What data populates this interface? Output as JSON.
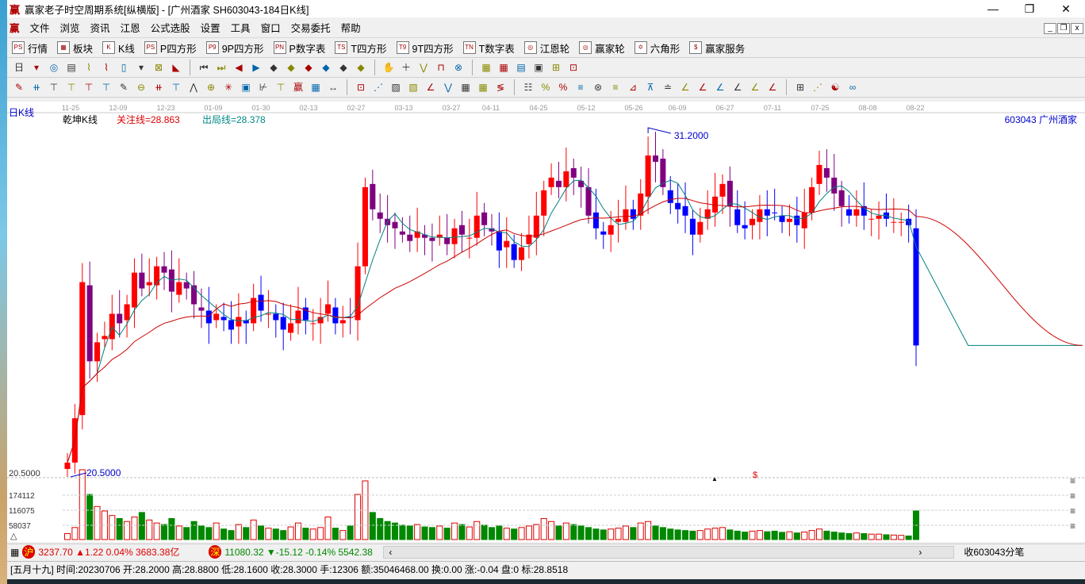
{
  "title": "赢家老子时空周期系统[纵横版] - [广州酒家  SH603043-184日K线]",
  "logo": "赢",
  "menu": [
    "文件",
    "浏览",
    "资讯",
    "江恩",
    "公式选股",
    "设置",
    "工具",
    "窗口",
    "交易委托",
    "帮助"
  ],
  "toolbar1": [
    {
      "icon": "PS",
      "label": "行情"
    },
    {
      "icon": "▦",
      "label": "板块"
    },
    {
      "icon": "K",
      "label": "K线"
    },
    {
      "icon": "PS",
      "label": "P四方形"
    },
    {
      "icon": "P9",
      "label": "9P四方形"
    },
    {
      "icon": "PN",
      "label": "P数字表"
    },
    {
      "icon": "TS",
      "label": "T四方形"
    },
    {
      "icon": "T9",
      "label": "9T四方形"
    },
    {
      "icon": "TN",
      "label": "T数字表"
    },
    {
      "icon": "◎",
      "label": "江恩轮"
    },
    {
      "icon": "◎",
      "label": "赢家轮"
    },
    {
      "icon": "✡",
      "label": "六角形"
    },
    {
      "icon": "$",
      "label": "赢家服务"
    }
  ],
  "toolbar2_period": "日",
  "chart": {
    "period_label": "日K线",
    "indicator": "乾坤K线",
    "focus_line": "关注线=28.863",
    "exit_line": "出局线=28.378",
    "stock": "603043 广州酒家",
    "high_label": "31.2000",
    "low_label": "20.5000",
    "axis_low": "20.5000",
    "dates": [
      "11-25",
      "12-09",
      "12-23",
      "01-09",
      "01-30",
      "02-13",
      "02-27",
      "03-13",
      "03-27",
      "04-11",
      "04-25",
      "05-12",
      "05-26",
      "06-09",
      "06-27",
      "07-11",
      "07-25",
      "08-08",
      "08-22"
    ],
    "vol_ticks": [
      "174112",
      "116075",
      "58037"
    ],
    "colors": {
      "up": "#ff0000",
      "down": "#0000ff",
      "down_alt": "#800080",
      "ma_short": "#008080",
      "ma_long": "#cc0000"
    }
  },
  "chart_data": {
    "type": "candlestick",
    "price_range": [
      20.5,
      31.2
    ],
    "closes": [
      20.8,
      22.2,
      26.5,
      24.0,
      24.6,
      24.8,
      25.5,
      25.2,
      25.8,
      26.8,
      26.3,
      26.5,
      27.0,
      26.8,
      26.2,
      26.5,
      26.3,
      25.8,
      25.6,
      25.2,
      25.5,
      25.3,
      25.0,
      25.4,
      25.2,
      26.0,
      25.6,
      25.5,
      25.3,
      25.0,
      25.2,
      25.6,
      25.3,
      25.2,
      25.4,
      25.8,
      25.2,
      25.3,
      25.4,
      27.0,
      29.5,
      28.8,
      28.5,
      28.3,
      28.2,
      28.0,
      27.8,
      28.1,
      27.9,
      27.8,
      28.0,
      27.7,
      28.2,
      28.0,
      27.9,
      28.6,
      28.3,
      28.1,
      27.5,
      27.8,
      27.2,
      27.6,
      28.0,
      28.6,
      29.4,
      29.8,
      29.5,
      30.0,
      29.8,
      29.5,
      28.6,
      28.2,
      28.0,
      28.3,
      28.5,
      28.8,
      28.5,
      29.3,
      30.5,
      30.3,
      29.5,
      29.0,
      28.8,
      28.6,
      28.0,
      28.4,
      28.8,
      29.2,
      29.6,
      28.9,
      28.3,
      28.2,
      28.5,
      28.8,
      28.6,
      28.7,
      28.4,
      28.5,
      28.3,
      28.7,
      29.5,
      30.2,
      29.8,
      29.3,
      28.9,
      28.6,
      28.8,
      28.6,
      28.5,
      28.6,
      28.5,
      28.4,
      28.4,
      28.3,
      24.5
    ],
    "volumes": [
      20,
      40,
      232,
      150,
      110,
      95,
      80,
      70,
      60,
      75,
      90,
      65,
      55,
      50,
      70,
      45,
      40,
      60,
      45,
      40,
      55,
      35,
      30,
      50,
      40,
      65,
      45,
      38,
      35,
      30,
      42,
      55,
      38,
      35,
      40,
      75,
      38,
      30,
      45,
      150,
      195,
      90,
      70,
      60,
      55,
      48,
      45,
      50,
      42,
      40,
      45,
      38,
      55,
      50,
      42,
      60,
      48,
      40,
      45,
      38,
      35,
      40,
      45,
      50,
      70,
      60,
      45,
      55,
      50,
      45,
      40,
      35,
      32,
      35,
      38,
      45,
      40,
      55,
      60,
      45,
      40,
      35,
      32,
      30,
      28,
      30,
      35,
      38,
      40,
      32,
      28,
      25,
      28,
      30,
      26,
      28,
      24,
      26,
      22,
      25,
      30,
      35,
      28,
      25,
      22,
      20,
      22,
      20,
      18,
      18,
      16,
      15,
      14,
      12,
      95
    ]
  },
  "status": {
    "sh": "沪",
    "sh_text": "3237.70 ▲1.22 0.04% 3683.38亿",
    "sz": "深",
    "sz_text": "11080.32 ▼-15.12 -0.14% 5542.38",
    "right": "收603043分笔"
  },
  "info": "[五月十九] 时间:20230706 开:28.2000 高:28.8800 低:28.1600 收:28.3000 手:12306 额:35046468.00 换:0.00 涨:-0.04 盘:0 标:28.8518"
}
